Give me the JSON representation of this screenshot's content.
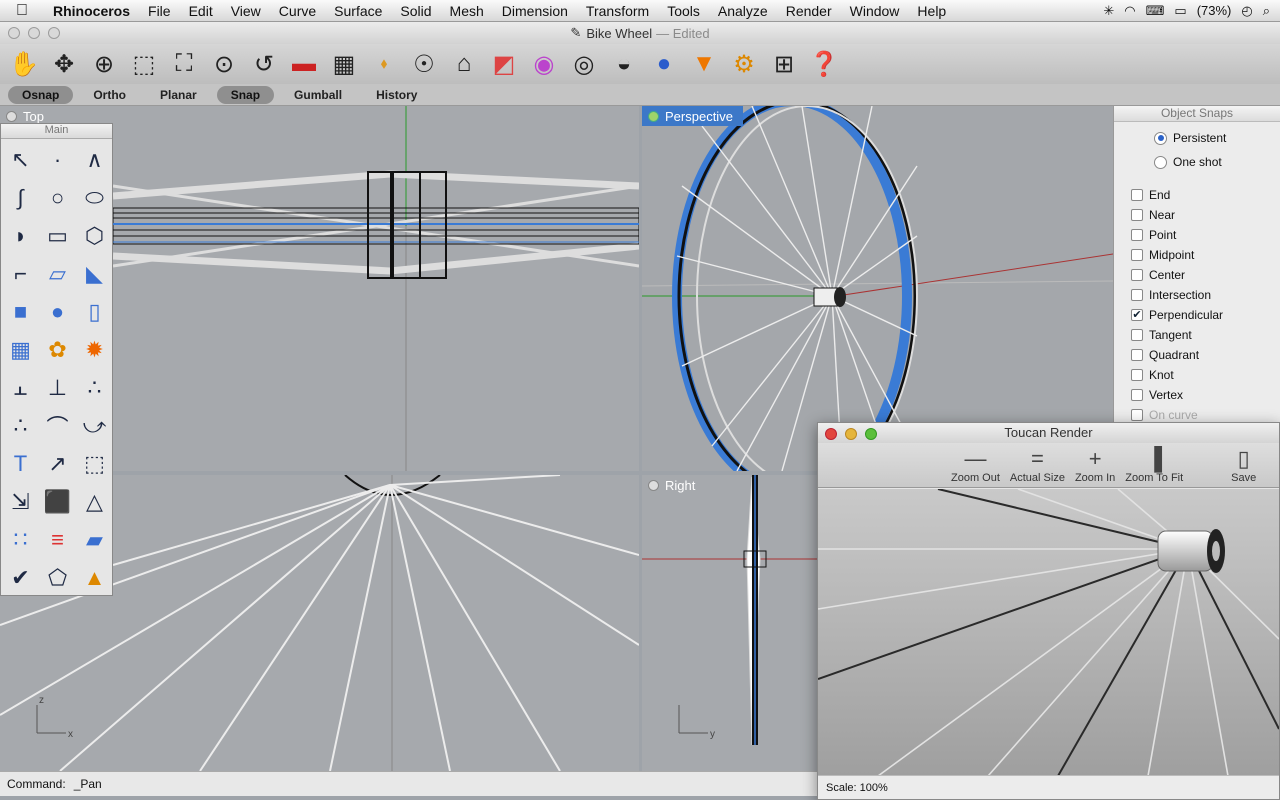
{
  "menubar": {
    "apple_icon": "apple-icon",
    "app_name": "Rhinoceros",
    "items": [
      "File",
      "Edit",
      "View",
      "Curve",
      "Surface",
      "Solid",
      "Mesh",
      "Dimension",
      "Transform",
      "Tools",
      "Analyze",
      "Render",
      "Window",
      "Help"
    ],
    "battery": "(73%)"
  },
  "window": {
    "title": "Bike Wheel",
    "edited": "— Edited"
  },
  "modes": [
    {
      "label": "Osnap",
      "on": true
    },
    {
      "label": "Ortho",
      "on": false
    },
    {
      "label": "Planar",
      "on": false
    },
    {
      "label": "Snap",
      "on": true
    },
    {
      "label": "Gumball",
      "on": false
    },
    {
      "label": "History",
      "on": false
    }
  ],
  "viewports": {
    "top": "Top",
    "perspective": "Perspective",
    "right": "Right"
  },
  "palette": {
    "title": "Main"
  },
  "object_snaps": {
    "title": "Object Snaps",
    "mode_persistent": "Persistent",
    "mode_oneshot": "One shot",
    "options": [
      {
        "label": "End",
        "checked": false
      },
      {
        "label": "Near",
        "checked": false
      },
      {
        "label": "Point",
        "checked": false
      },
      {
        "label": "Midpoint",
        "checked": false
      },
      {
        "label": "Center",
        "checked": false
      },
      {
        "label": "Intersection",
        "checked": false
      },
      {
        "label": "Perpendicular",
        "checked": true
      },
      {
        "label": "Tangent",
        "checked": false
      },
      {
        "label": "Quadrant",
        "checked": false
      },
      {
        "label": "Knot",
        "checked": false
      },
      {
        "label": "Vertex",
        "checked": false
      },
      {
        "label": "On curve",
        "checked": false
      }
    ]
  },
  "toucan": {
    "title": "Toucan Render",
    "buttons": {
      "zoom_out": "Zoom Out",
      "actual_size": "Actual Size",
      "zoom_in": "Zoom In",
      "zoom_fit": "Zoom To Fit",
      "save": "Save"
    },
    "status": "Scale: 100%"
  },
  "command": {
    "label": "Command:",
    "value": "_Pan"
  },
  "axes": {
    "x": "x",
    "y": "y",
    "z": "z"
  }
}
